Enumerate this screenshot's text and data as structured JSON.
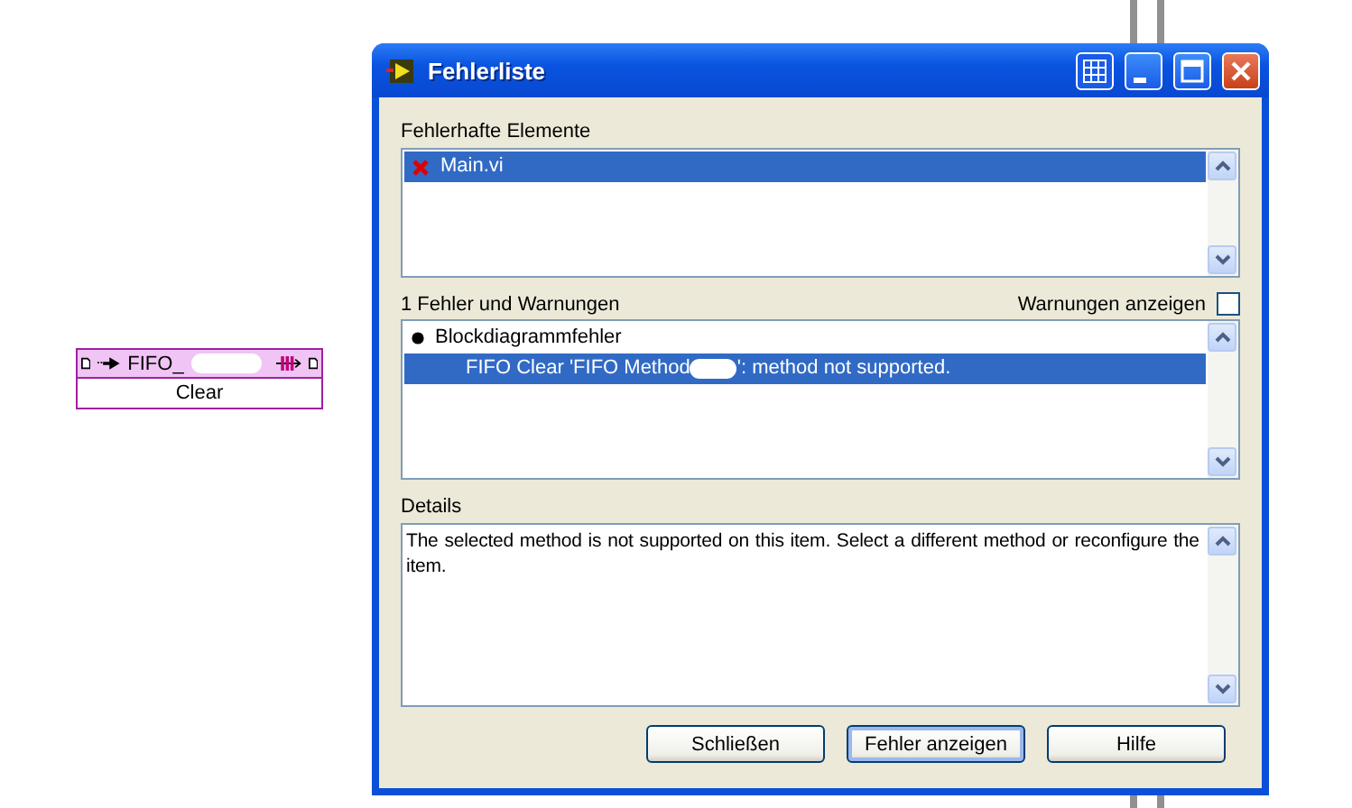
{
  "canvas_node": {
    "title_prefix": "FIFO_",
    "method": "Clear"
  },
  "window": {
    "title": "Fehlerliste"
  },
  "items_section": {
    "label": "Fehlerhafte Elemente",
    "items": [
      {
        "name": "Main.vi",
        "selected": true
      }
    ]
  },
  "errors_section": {
    "label": "1 Fehler und Warnungen",
    "show_warnings": {
      "label": "Warnungen anzeigen",
      "checked": false
    },
    "items": [
      {
        "kind": "group",
        "label": "Blockdiagrammfehler",
        "selected": false
      },
      {
        "kind": "error",
        "label_start": "FIFO Clear 'FIFO Method",
        "label_end": "': method not supported.",
        "selected": true
      }
    ]
  },
  "details": {
    "label": "Details",
    "text": "The selected method is not supported on this item. Select a different method or reconfigure the item."
  },
  "buttons": [
    {
      "label": "Schließen",
      "default": false
    },
    {
      "label": "Fehler anzeigen",
      "default": true
    },
    {
      "label": "Hilfe",
      "default": false
    }
  ]
}
